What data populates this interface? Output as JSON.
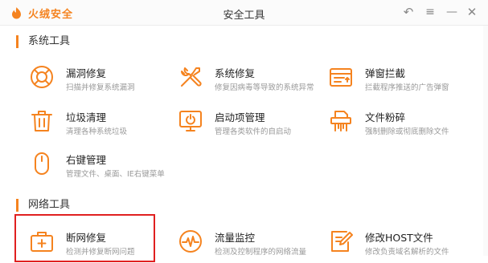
{
  "app": {
    "logo_text": "火绒安全",
    "window_title": "安全工具"
  },
  "sections": {
    "system": {
      "title": "系统工具"
    },
    "network": {
      "title": "网络工具"
    }
  },
  "tools": {
    "vuln_repair": {
      "name": "漏洞修复",
      "desc": "扫描并修复系统漏洞",
      "icon": "lifebuoy-icon"
    },
    "system_repair": {
      "name": "系统修复",
      "desc": "修复因病毒等导致的系统异常",
      "icon": "wrench-screwdriver-icon"
    },
    "popup_block": {
      "name": "弹窗拦截",
      "desc": "拦截程序推送的广告弹窗",
      "icon": "popup-window-icon"
    },
    "junk_clean": {
      "name": "垃圾清理",
      "desc": "清理各种系统垃圾",
      "icon": "trash-icon"
    },
    "startup_mgmt": {
      "name": "启动项管理",
      "desc": "管理各类软件的自启动",
      "icon": "monitor-power-icon"
    },
    "file_shredder": {
      "name": "文件粉碎",
      "desc": "强制删除或彻底删除文件",
      "icon": "shredder-icon"
    },
    "context_menu": {
      "name": "右键管理",
      "desc": "管理文件、桌面、IE右键菜单",
      "icon": "mouse-icon"
    },
    "net_repair": {
      "name": "断网修复",
      "desc": "检测并修复断网问题",
      "icon": "briefcase-plus-icon"
    },
    "traffic_monitor": {
      "name": "流量监控",
      "desc": "检测及控制程序的网络流量",
      "icon": "gauge-icon"
    },
    "host_edit": {
      "name": "修改HOST文件",
      "desc": "修改负责域名解析的文件",
      "icon": "edit-document-icon"
    }
  },
  "colors": {
    "accent": "#f5831f",
    "highlight": "#e02020"
  }
}
